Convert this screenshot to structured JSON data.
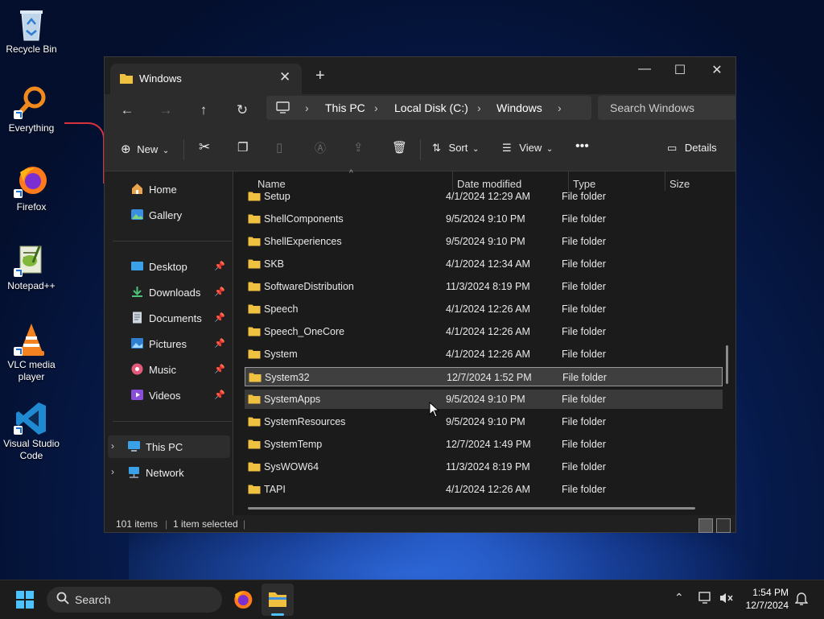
{
  "desktop": {
    "icons": [
      {
        "label": "Recycle Bin",
        "icon": "recycle-bin-icon"
      },
      {
        "label": "Everything",
        "icon": "everything-search-icon"
      },
      {
        "label": "Firefox",
        "icon": "firefox-icon"
      },
      {
        "label": "Notepad++",
        "icon": "notepad-plus-plus-icon"
      },
      {
        "label": "VLC media player",
        "icon": "vlc-icon"
      },
      {
        "label": "Visual Studio Code",
        "icon": "vscode-icon"
      }
    ]
  },
  "window": {
    "tab_title": "Windows",
    "breadcrumb": [
      "This PC",
      "Local Disk (C:)",
      "Windows"
    ],
    "search_placeholder": "Search Windows",
    "toolbar": {
      "new_label": "New",
      "sort_label": "Sort",
      "view_label": "View",
      "details_label": "Details"
    },
    "sidebar": {
      "top": [
        {
          "label": "Home",
          "icon": "home-icon"
        },
        {
          "label": "Gallery",
          "icon": "gallery-icon"
        }
      ],
      "quick": [
        {
          "label": "Desktop",
          "icon": "desktop-icon"
        },
        {
          "label": "Downloads",
          "icon": "download-icon"
        },
        {
          "label": "Documents",
          "icon": "documents-icon"
        },
        {
          "label": "Pictures",
          "icon": "pictures-icon"
        },
        {
          "label": "Music",
          "icon": "music-icon"
        },
        {
          "label": "Videos",
          "icon": "videos-icon"
        }
      ],
      "tree": [
        {
          "label": "This PC",
          "icon": "computer-icon"
        },
        {
          "label": "Network",
          "icon": "network-icon"
        }
      ]
    },
    "columns": [
      "Name",
      "Date modified",
      "Type",
      "Size"
    ],
    "rows": [
      {
        "name": "Setup",
        "date": "4/1/2024 12:29 AM",
        "type": "File folder"
      },
      {
        "name": "ShellComponents",
        "date": "9/5/2024 9:10 PM",
        "type": "File folder"
      },
      {
        "name": "ShellExperiences",
        "date": "9/5/2024 9:10 PM",
        "type": "File folder"
      },
      {
        "name": "SKB",
        "date": "4/1/2024 12:34 AM",
        "type": "File folder"
      },
      {
        "name": "SoftwareDistribution",
        "date": "11/3/2024 8:19 PM",
        "type": "File folder"
      },
      {
        "name": "Speech",
        "date": "4/1/2024 12:26 AM",
        "type": "File folder"
      },
      {
        "name": "Speech_OneCore",
        "date": "4/1/2024 12:26 AM",
        "type": "File folder"
      },
      {
        "name": "System",
        "date": "4/1/2024 12:26 AM",
        "type": "File folder"
      },
      {
        "name": "System32",
        "date": "12/7/2024 1:52 PM",
        "type": "File folder"
      },
      {
        "name": "SystemApps",
        "date": "9/5/2024 9:10 PM",
        "type": "File folder"
      },
      {
        "name": "SystemResources",
        "date": "9/5/2024 9:10 PM",
        "type": "File folder"
      },
      {
        "name": "SystemTemp",
        "date": "12/7/2024 1:49 PM",
        "type": "File folder"
      },
      {
        "name": "SysWOW64",
        "date": "11/3/2024 8:19 PM",
        "type": "File folder"
      },
      {
        "name": "TAPI",
        "date": "4/1/2024 12:26 AM",
        "type": "File folder"
      }
    ],
    "selected_row": "System32",
    "hover_row": "SystemApps",
    "status": {
      "items": "101 items",
      "selected": "1 item selected"
    }
  },
  "taskbar": {
    "search_label": "Search",
    "time": "1:54 PM",
    "date": "12/7/2024"
  },
  "colors": {
    "accent": "#4cc2ff",
    "folder": "#f0c040",
    "window_bg": "#202020"
  }
}
